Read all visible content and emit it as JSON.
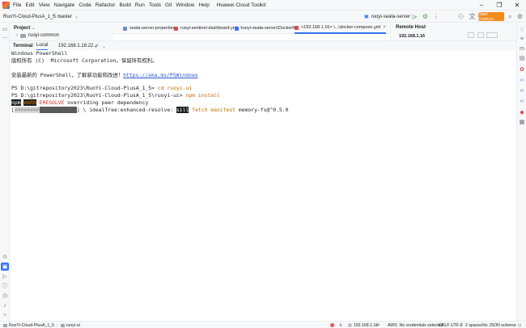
{
  "menubar": {
    "items": [
      "File",
      "Edit",
      "View",
      "Navigate",
      "Code",
      "Refactor",
      "Build",
      "Run",
      "Tools",
      "Git",
      "Window",
      "Help"
    ],
    "app_title": "Huawei Cloud Toolkit",
    "controls": [
      "–",
      "❐",
      "✕"
    ]
  },
  "toolbar": {
    "project": "RuoYi-Cloud-PlusA_1_5",
    "branch": "master",
    "run_config": "ruoyi-seata-server",
    "start_feature": "Start Feature"
  },
  "project_panel": {
    "title": "Project",
    "module": "ruoyi-common"
  },
  "editor_tabs": [
    {
      "label": "seata-server.properties",
      "color": "#6c8ebf",
      "active": false
    },
    {
      "label": "ruoyi-sentinel-dashboard.yml",
      "color": "#d64b4b",
      "active": false
    },
    {
      "label": "ruoyi-seata-server\\Dockerfile",
      "color": "#3574f0",
      "active": false
    },
    {
      "label": "<192.168.1.16> \\...\\docker-compose.yml",
      "color": "#d64b4b",
      "active": true
    }
  ],
  "remote_host": {
    "title": "Remote Host",
    "host": "192.168.1.16"
  },
  "terminal": {
    "tabs": [
      {
        "label": "Terminal",
        "bold": true
      },
      {
        "label": "Local",
        "active": true
      },
      {
        "label": "192.168.1.16:22"
      }
    ],
    "add": "+",
    "chevron": "⌄",
    "lines": {
      "l1": "Windows PowerShell",
      "l2": "版权所有 (C)  Microsoft Corporation。保留所有权利。",
      "l3_prefix": "安装最新的 PowerShell，了解新功能和改进！",
      "l3_link": "https://aka.ms/PSWindows",
      "l4_prompt": "PS D:\\gitrepository2023\\RuoYi-Cloud-PlusA_1_5> ",
      "l4_cmd": "cd ruoyi-ui",
      "l5_prompt": "PS D:\\gitrepository2023\\RuoYi-Cloud-PlusA_1_5\\ruoyi-ui> ",
      "l5_cmd": "npm install",
      "l6_npm": "npm",
      "l6_warn": "WARN",
      "l6_eresolve": "ERESOLVE",
      "l6_rest": " overriding peer dependency",
      "l7_open": "[",
      "l7_prog_a": "########",
      "l7_prog_b": "############",
      "l7_mid": "] \\ idealTree:enhanced-resolve: ",
      "l7_sill": "sill",
      "l7_fetch": " fetch manifest ",
      "l7_pkg": "memory-fs@^0.5.0"
    }
  },
  "statusbar": {
    "project": "RuoYi-Cloud-PlusA_1_5",
    "module": "ruoyi-ui",
    "host": "192.168.1.16",
    "aws": "AWS: No credentials selected",
    "line_ending": "CRLF",
    "encoding": "UTF-8",
    "indent": "2 spaces",
    "schema": "No JSON schema"
  }
}
